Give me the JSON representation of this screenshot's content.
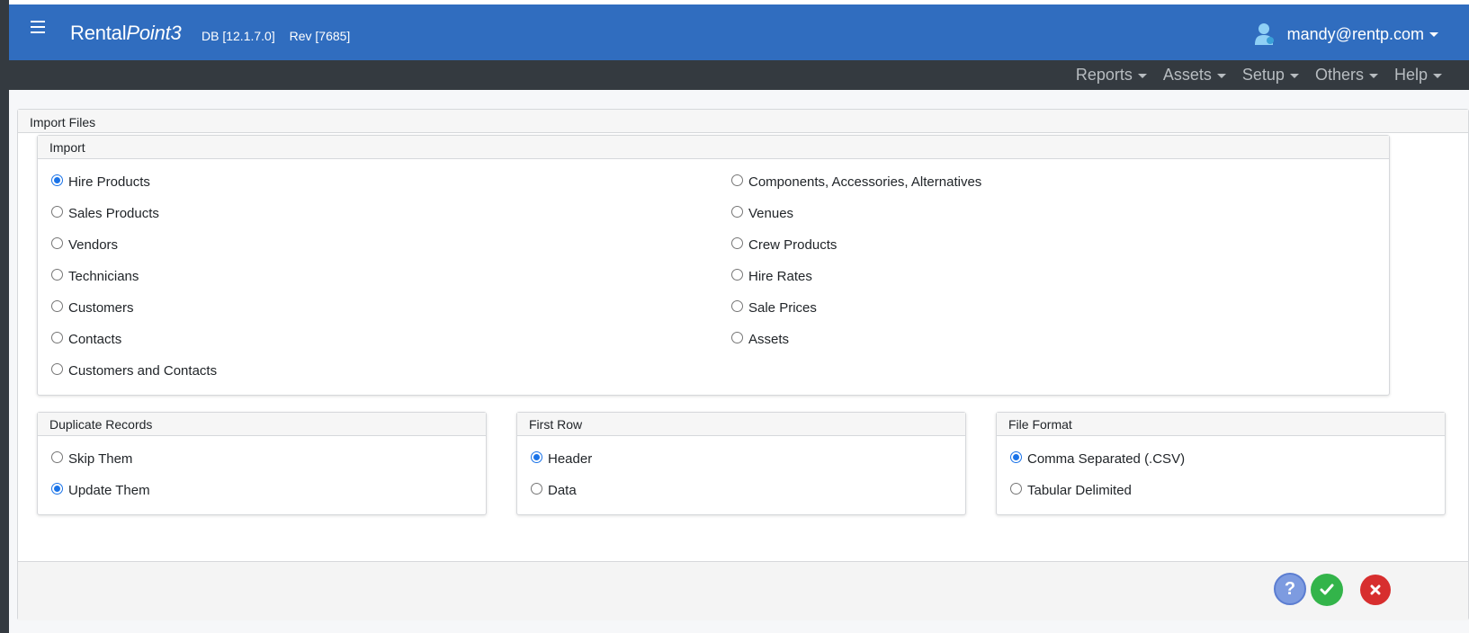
{
  "app": {
    "brand_plain": "Rental",
    "brand_italic": "Point3",
    "db_version": "DB [12.1.7.0]",
    "revision": "Rev [7685]",
    "user_email": "mandy@rentp.com"
  },
  "nav": [
    "Reports",
    "Assets",
    "Setup",
    "Others",
    "Help"
  ],
  "page": {
    "title": "Import Files"
  },
  "import": {
    "title": "Import",
    "selected": "Hire Products",
    "left": [
      "Hire Products",
      "Sales Products",
      "Vendors",
      "Technicians",
      "Customers",
      "Contacts",
      "Customers and Contacts"
    ],
    "right": [
      "Components, Accessories, Alternatives",
      "Venues",
      "Crew Products",
      "Hire Rates",
      "Sale Prices",
      "Assets"
    ]
  },
  "duplicate": {
    "title": "Duplicate Records",
    "options": [
      "Skip Them",
      "Update Them"
    ],
    "selected": "Update Them"
  },
  "first_row": {
    "title": "First Row",
    "options": [
      "Header",
      "Data"
    ],
    "selected": "Header"
  },
  "file_format": {
    "title": "File Format",
    "options": [
      "Comma Separated (.CSV)",
      "Tabular Delimited"
    ],
    "selected": "Comma Separated (.CSV)"
  },
  "footer": {
    "help_icon": "question-icon",
    "ok_icon": "check-icon",
    "cancel_icon": "close-icon"
  },
  "colors": {
    "header_blue": "#306dbf",
    "navbar_dark": "#343a40",
    "ok_green": "#33b44a",
    "cancel_red": "#d72e2e",
    "help_blue": "#7d9be0"
  }
}
